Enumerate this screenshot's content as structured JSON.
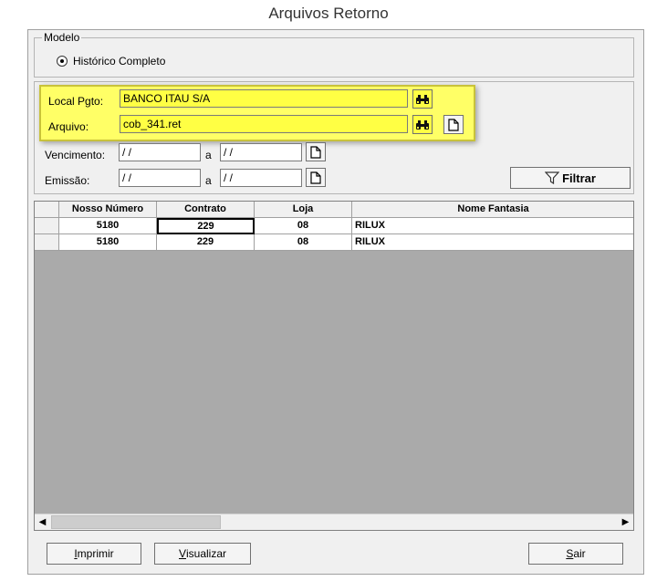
{
  "window": {
    "title": "Arquivos Retorno"
  },
  "modelo": {
    "legend": "Modelo",
    "option_label": "Histórico Completo",
    "selected": true
  },
  "filters": {
    "local_pgto": {
      "label": "Local Pgto:",
      "value": "BANCO ITAU S/A"
    },
    "arquivo": {
      "label": "Arquivo:",
      "value": "cob_341.ret"
    },
    "vencimento": {
      "label": "Vencimento:",
      "from": " / /",
      "sep": "a",
      "to": " / /"
    },
    "emissao": {
      "label": "Emissão:",
      "from": " / /",
      "sep": "a",
      "to": " / /"
    },
    "filtrar_label": "Filtrar"
  },
  "grid": {
    "columns": [
      "Nosso Número",
      "Contrato",
      "Loja",
      "Nome Fantasia"
    ],
    "rows": [
      {
        "nosso_numero": "5180",
        "contrato": "229",
        "loja": "08",
        "nome_fantasia": "RILUX"
      },
      {
        "nosso_numero": "5180",
        "contrato": "229",
        "loja": "08",
        "nome_fantasia": "RILUX"
      }
    ]
  },
  "buttons": {
    "imprimir": {
      "u": "I",
      "rest": "mprimir"
    },
    "visualizar": {
      "u": "V",
      "rest": "isualizar"
    },
    "sair": {
      "u": "S",
      "rest": "air"
    }
  },
  "icons": {
    "search": "binoculars-icon",
    "clear": "blank-page-icon",
    "filter": "funnel-icon"
  },
  "colors": {
    "highlight": "#ffff44",
    "grid_empty": "#aaaaaa",
    "window_bg": "#f0f0f0"
  }
}
